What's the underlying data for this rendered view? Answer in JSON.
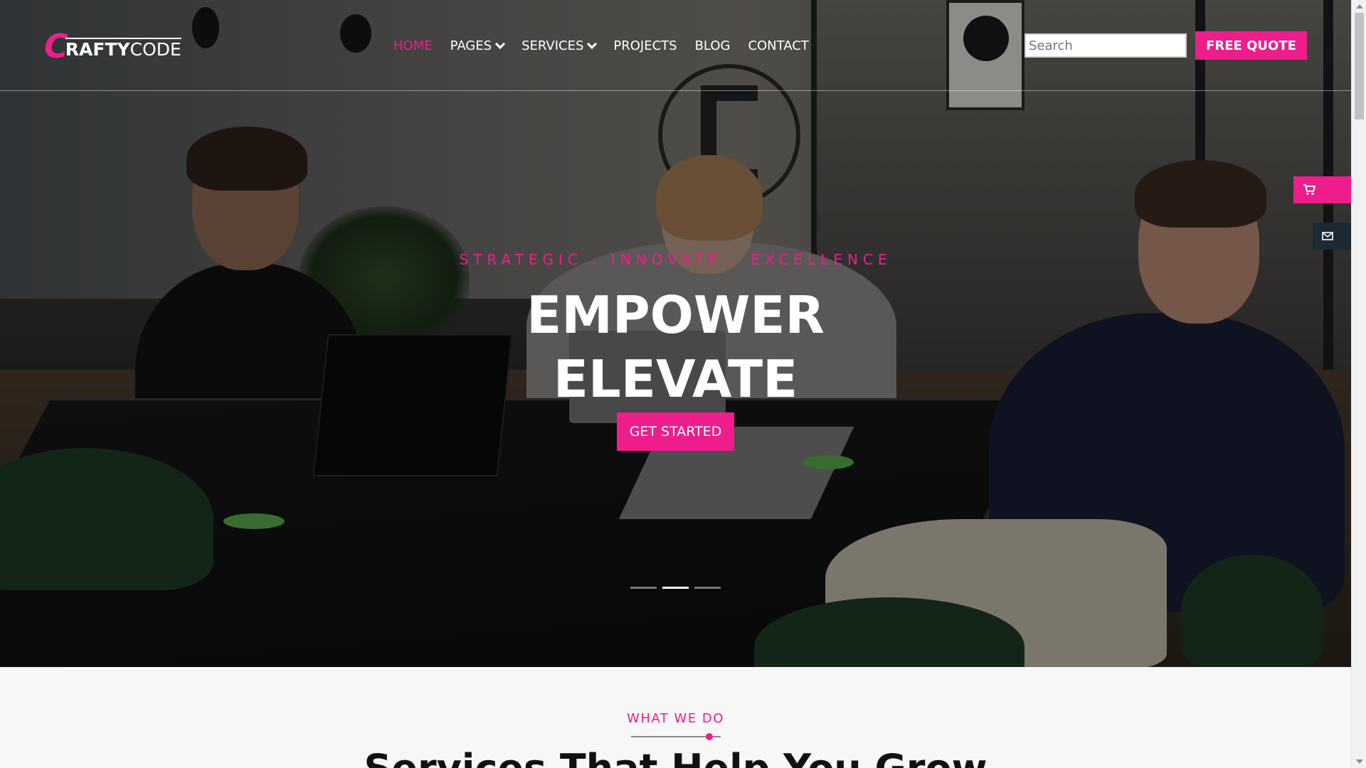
{
  "header": {
    "logo": {
      "initial": "C",
      "rest": "RAFTY",
      "suffix": "CODE"
    },
    "nav": [
      {
        "label": "HOME",
        "active": true,
        "dropdown": false
      },
      {
        "label": "PAGES",
        "active": false,
        "dropdown": true
      },
      {
        "label": "SERVICES",
        "active": false,
        "dropdown": true
      },
      {
        "label": "PROJECTS",
        "active": false,
        "dropdown": false
      },
      {
        "label": "BLOG",
        "active": false,
        "dropdown": false
      },
      {
        "label": "CONTACT",
        "active": false,
        "dropdown": false
      }
    ],
    "search": {
      "placeholder": "Search",
      "value": ""
    },
    "cta_label": "FREE QUOTE"
  },
  "hero": {
    "tagline": "STRATEGIC . INNOVATE . EXCELLENCE",
    "headline_line1": "EMPOWER",
    "headline_line2": "ELEVATE",
    "button_label": "GET STARTED",
    "slides": {
      "count": 3,
      "active_index": 1
    }
  },
  "side_widgets": {
    "cart_icon": "cart-icon",
    "mail_icon": "envelope-icon"
  },
  "section": {
    "eyebrow": "WHAT WE DO",
    "title": "Services That Help You Grow"
  },
  "colors": {
    "accent": "#ed1e8c",
    "dark_widget": "#1b2a33",
    "section_bg": "#f7f7f7"
  }
}
